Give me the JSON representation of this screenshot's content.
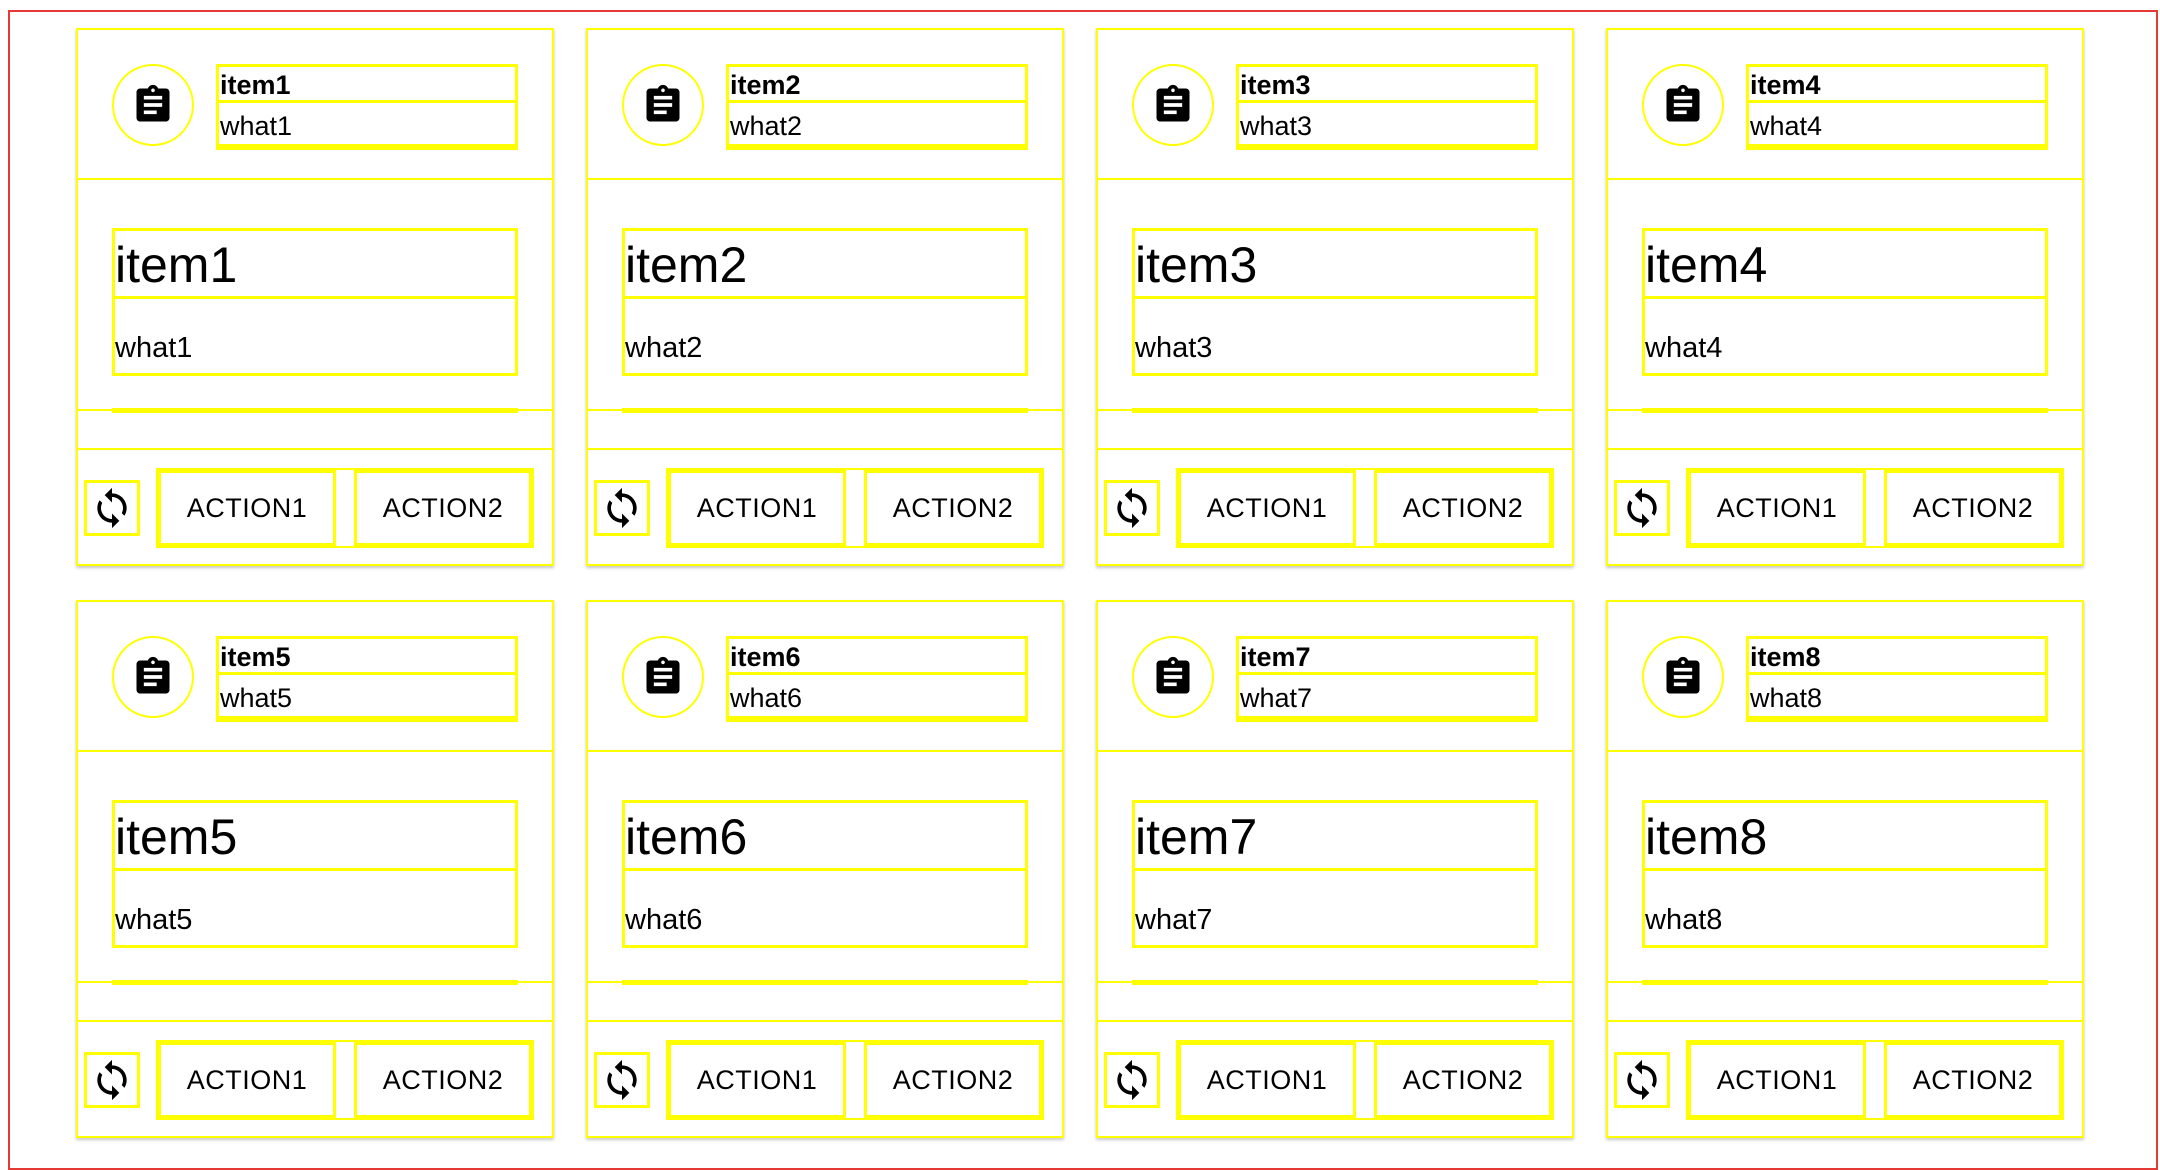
{
  "cards": [
    {
      "header_title": "item1",
      "header_subtitle": "what1",
      "title": "item1",
      "subtitle": "what1",
      "action1": "ACTION1",
      "action2": "ACTION2"
    },
    {
      "header_title": "item2",
      "header_subtitle": "what2",
      "title": "item2",
      "subtitle": "what2",
      "action1": "ACTION1",
      "action2": "ACTION2"
    },
    {
      "header_title": "item3",
      "header_subtitle": "what3",
      "title": "item3",
      "subtitle": "what3",
      "action1": "ACTION1",
      "action2": "ACTION2"
    },
    {
      "header_title": "item4",
      "header_subtitle": "what4",
      "title": "item4",
      "subtitle": "what4",
      "action1": "ACTION1",
      "action2": "ACTION2"
    },
    {
      "header_title": "item5",
      "header_subtitle": "what5",
      "title": "item5",
      "subtitle": "what5",
      "action1": "ACTION1",
      "action2": "ACTION2"
    },
    {
      "header_title": "item6",
      "header_subtitle": "what6",
      "title": "item6",
      "subtitle": "what6",
      "action1": "ACTION1",
      "action2": "ACTION2"
    },
    {
      "header_title": "item7",
      "header_subtitle": "what7",
      "title": "item7",
      "subtitle": "what7",
      "action1": "ACTION1",
      "action2": "ACTION2"
    },
    {
      "header_title": "item8",
      "header_subtitle": "what8",
      "title": "item8",
      "subtitle": "what8",
      "action1": "ACTION1",
      "action2": "ACTION2"
    }
  ],
  "icons": {
    "avatar": "clipboard-icon",
    "refresh": "refresh-icon"
  },
  "colors": {
    "outline": "#ffff00",
    "frame": "#e53935"
  }
}
